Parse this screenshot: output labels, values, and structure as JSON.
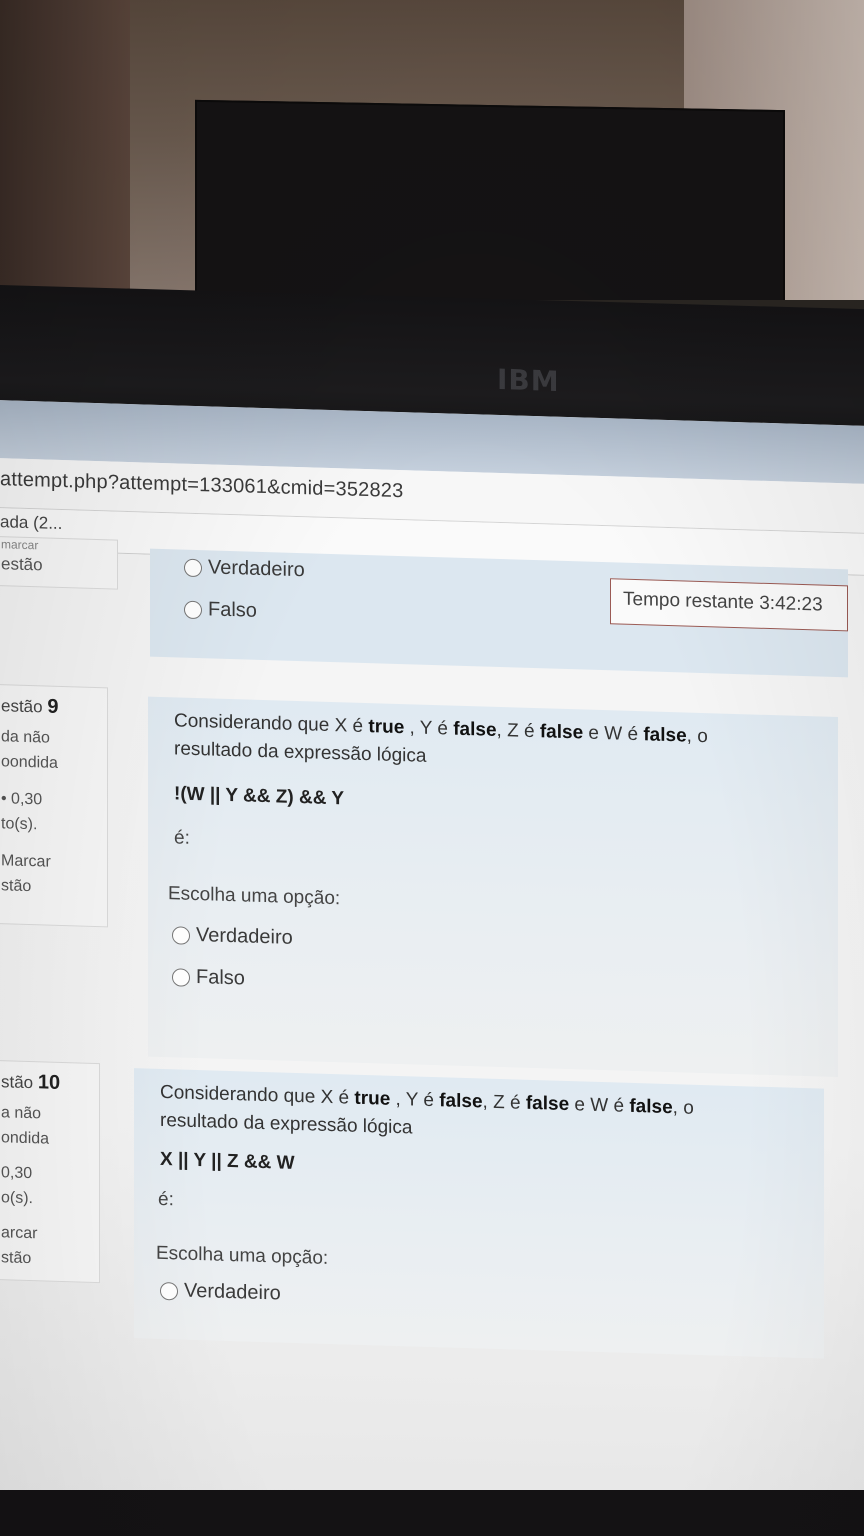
{
  "monitor": {
    "brand": "IBM"
  },
  "browser": {
    "url": "attempt.php?attempt=133061&cmid=352823",
    "tab_title": "ada (2..."
  },
  "timer": {
    "text": "Tempo restante 3:42:23"
  },
  "prev_question": {
    "sidebar_lines": [
      "marcar",
      "estão"
    ],
    "options": [
      "Verdadeiro",
      "Falso"
    ]
  },
  "question9": {
    "number_prefix": "estão",
    "number": "9",
    "status": [
      "da não",
      "oondida"
    ],
    "grade": [
      "• 0,30",
      "to(s)."
    ],
    "flag": [
      "Marcar",
      "stão"
    ],
    "text": {
      "p1": "Considerando que X é ",
      "x_val": "true",
      "p2": " , Y é ",
      "y_val": "false",
      "p3": ", Z é ",
      "z_val": "false",
      "p4": " e W é ",
      "w_val": "false",
      "p5": ", o",
      "line2": "resultado da expressão lógica"
    },
    "expression": "!(W || Y &&  Z) && Y",
    "is_label": "é:",
    "choose_label": "Escolha uma opção:",
    "options": [
      "Verdadeiro",
      "Falso"
    ]
  },
  "question10": {
    "number_prefix": "stão",
    "number": "10",
    "status": [
      "a não",
      "ondida"
    ],
    "grade": [
      "0,30",
      "o(s)."
    ],
    "flag": [
      "arcar",
      "stão"
    ],
    "text": {
      "p1": "Considerando que X é ",
      "x_val": "true",
      "p2": " , Y é ",
      "y_val": "false",
      "p3": ", Z é ",
      "z_val": "false",
      "p4": " e W é ",
      "w_val": "false",
      "p5": ", o",
      "line2": "resultado da expressão lógica"
    },
    "expression": "X || Y || Z && W",
    "is_label": "é:",
    "choose_label": "Escolha uma opção:",
    "options": [
      "Verdadeiro"
    ]
  }
}
